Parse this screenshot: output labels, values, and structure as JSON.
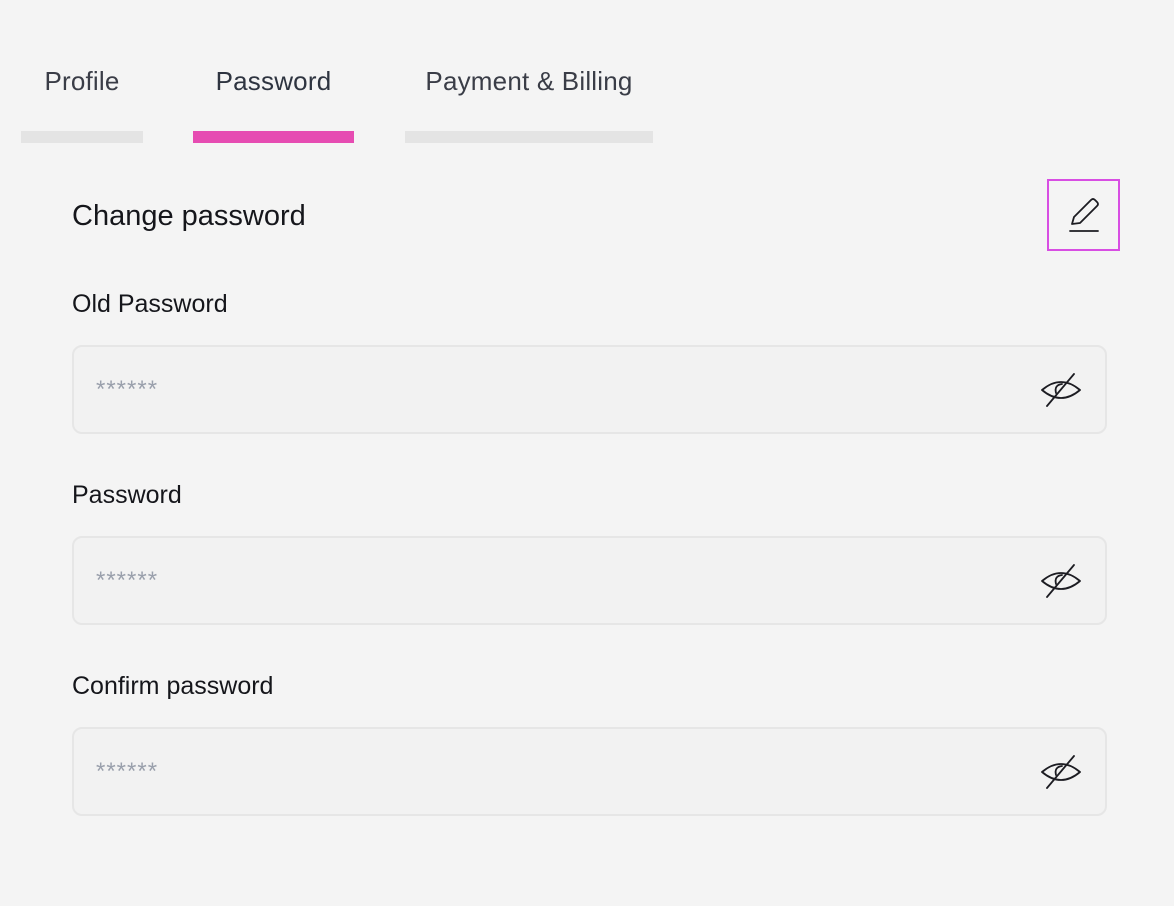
{
  "tabs": [
    {
      "label": "Profile",
      "active": false
    },
    {
      "label": "Password",
      "active": true
    },
    {
      "label": "Payment & Billing",
      "active": false
    }
  ],
  "colors": {
    "accent": "#e64cb2",
    "edit_highlight": "#d84ee3",
    "background": "#f4f4f4"
  },
  "section": {
    "title": "Change password",
    "edit_icon": "pencil-edit-icon"
  },
  "fields": {
    "old_password": {
      "label": "Old Password",
      "placeholder": "******",
      "icon": "eye-slash-icon"
    },
    "password": {
      "label": "Password",
      "placeholder": "******",
      "icon": "eye-slash-icon"
    },
    "confirm_password": {
      "label": "Confirm password",
      "placeholder": "******",
      "icon": "eye-slash-icon"
    }
  }
}
